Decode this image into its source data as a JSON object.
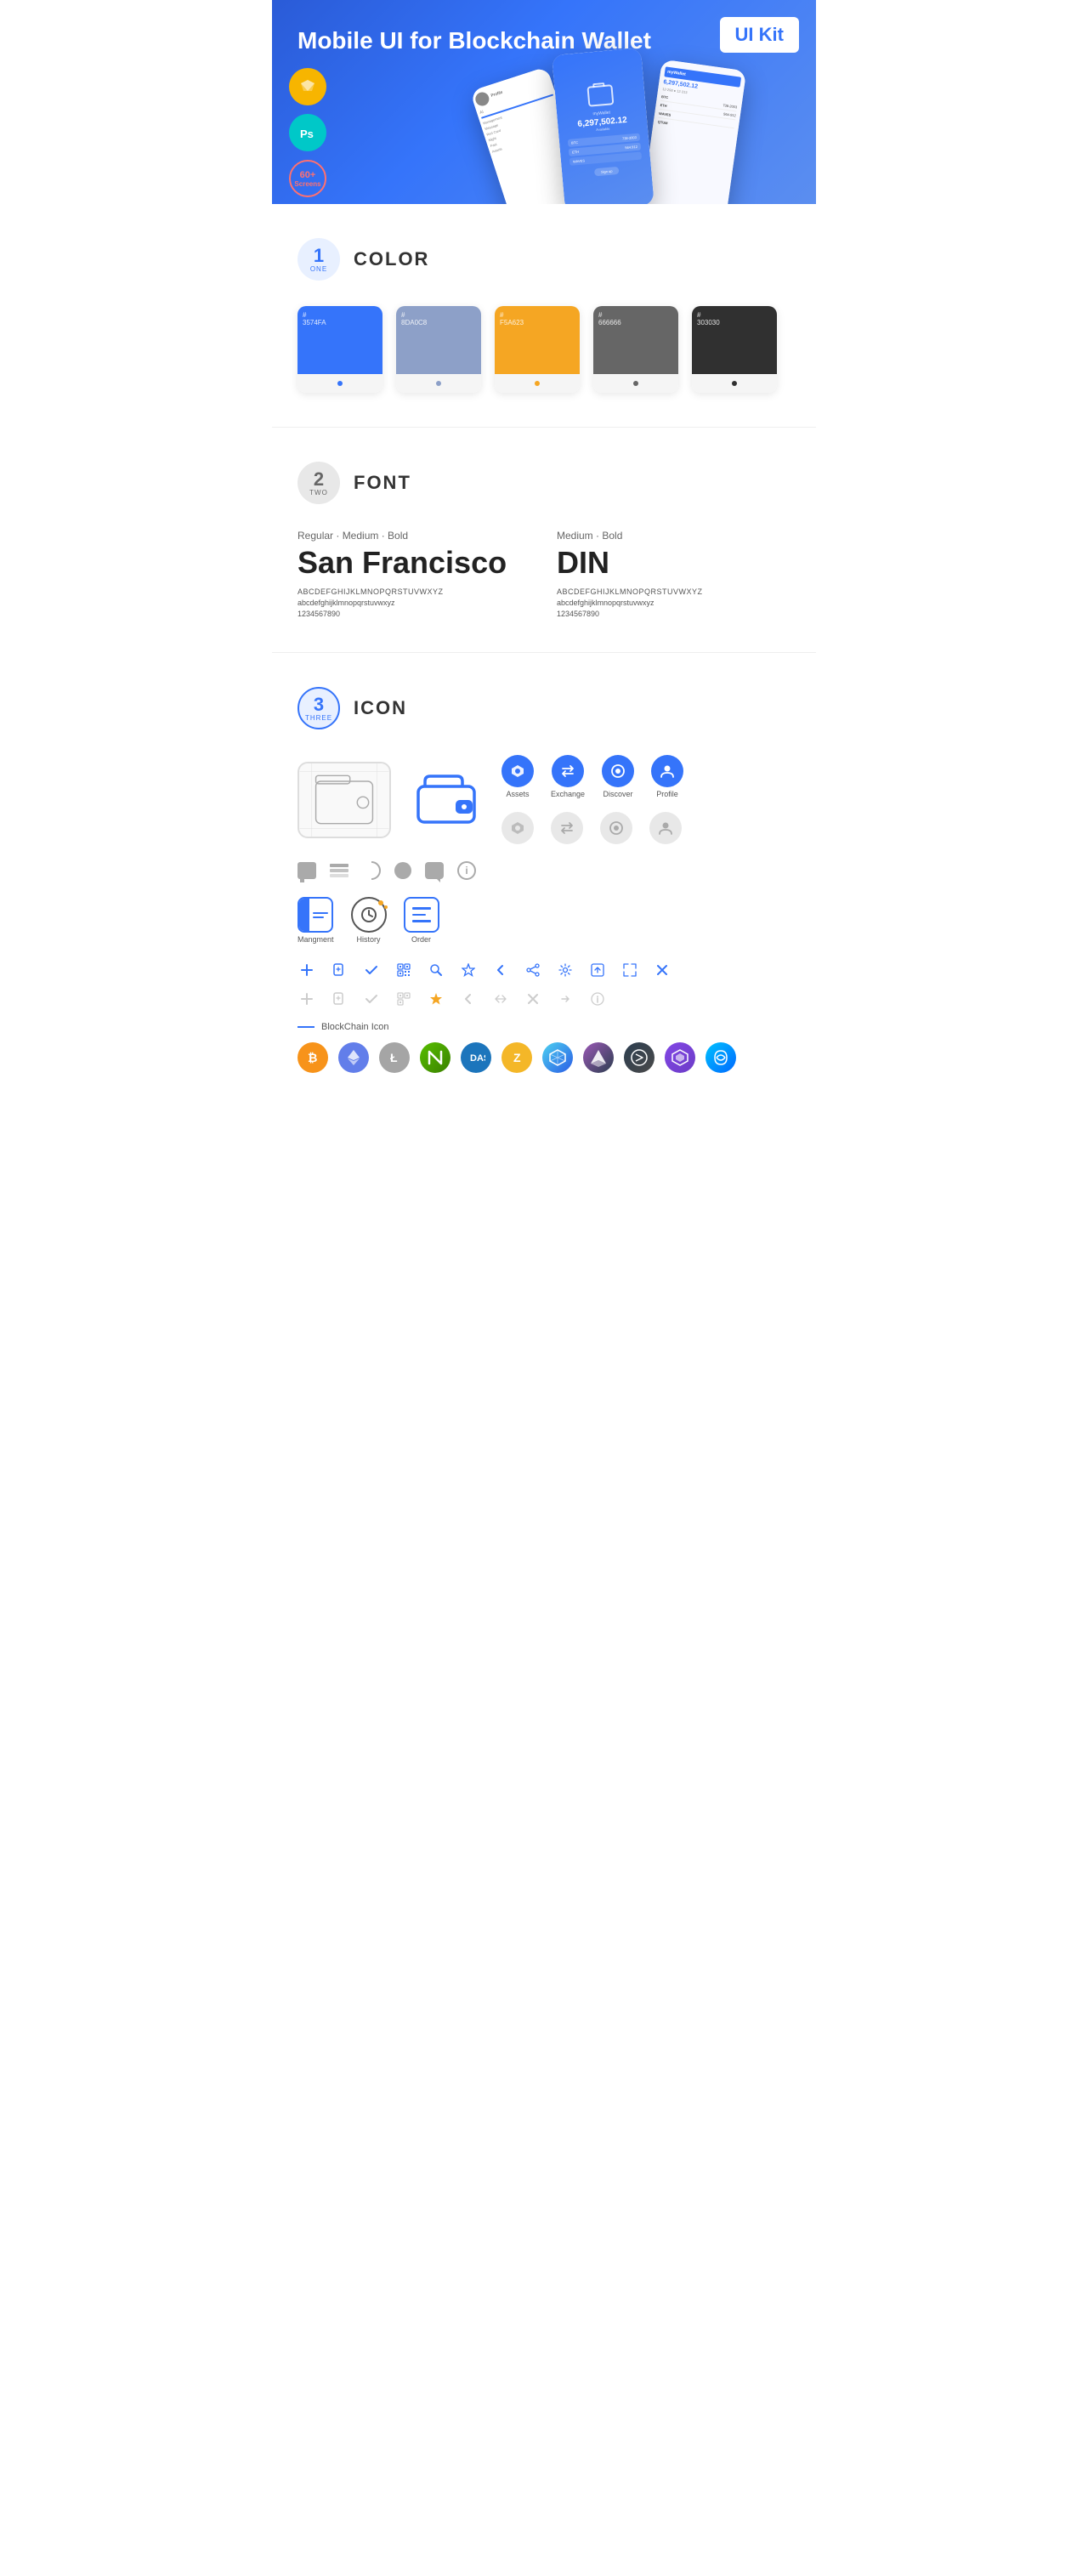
{
  "hero": {
    "title_regular": "Mobile UI for Blockchain ",
    "title_bold": "Wallet",
    "badge": "UI Kit",
    "badge_sketch": "S",
    "badge_ps": "Ps",
    "badge_screens_label": "60+",
    "badge_screens_sub": "Screens"
  },
  "sections": {
    "color": {
      "number": "1",
      "sub": "ONE",
      "title": "COLOR",
      "swatches": [
        {
          "hex": "#3574FA",
          "label": "3574FA"
        },
        {
          "hex": "#8DA0C8",
          "label": "8DA0C8"
        },
        {
          "hex": "#F5A623",
          "label": "F5A623"
        },
        {
          "hex": "#666666",
          "label": "666666"
        },
        {
          "hex": "#303030",
          "label": "303030"
        }
      ]
    },
    "font": {
      "number": "2",
      "sub": "TWO",
      "title": "FONT",
      "font1": {
        "style_label": "Regular · Medium · Bold",
        "name": "San Francisco",
        "uppercase": "ABCDEFGHIJKLMNOPQRSTUVWXYZ",
        "lowercase": "abcdefghijklmnopqrstuvwxyz",
        "numbers": "1234567890"
      },
      "font2": {
        "style_label": "Medium · Bold",
        "name": "DIN",
        "uppercase": "ABCDEFGHIJKLMNOPQRSTUVWXYZ",
        "lowercase": "abcdefghijklmnopqrstuvwxyz",
        "numbers": "1234567890"
      }
    },
    "icon": {
      "number": "3",
      "sub": "THREE",
      "title": "ICON",
      "nav_icons": [
        {
          "label": "Assets"
        },
        {
          "label": "Exchange"
        },
        {
          "label": "Discover"
        },
        {
          "label": "Profile"
        }
      ],
      "bottom_icons": [
        {
          "label": "Mangment"
        },
        {
          "label": "History"
        },
        {
          "label": "Order"
        }
      ],
      "blockchain_label": "BlockChain Icon",
      "crypto_icons": [
        {
          "name": "Bitcoin",
          "symbol": "₿",
          "color_class": "crypto-btc"
        },
        {
          "name": "Ethereum",
          "symbol": "Ξ",
          "color_class": "crypto-eth"
        },
        {
          "name": "Litecoin",
          "symbol": "Ł",
          "color_class": "crypto-ltc"
        },
        {
          "name": "NEO",
          "symbol": "N",
          "color_class": "crypto-neo"
        },
        {
          "name": "Dash",
          "symbol": "D",
          "color_class": "crypto-dash"
        },
        {
          "name": "Zcash",
          "symbol": "Z",
          "color_class": "crypto-zcash"
        },
        {
          "name": "Grid",
          "symbol": "◈",
          "color_class": "crypto-grid"
        },
        {
          "name": "Arrow",
          "symbol": "▲",
          "color_class": "crypto-arw"
        },
        {
          "name": "BTCP",
          "symbol": "⬡",
          "color_class": "crypto-btcp"
        },
        {
          "name": "Polygon",
          "symbol": "◆",
          "color_class": "crypto-polygon"
        },
        {
          "name": "Sky",
          "symbol": "~",
          "color_class": "crypto-sky"
        }
      ]
    }
  }
}
